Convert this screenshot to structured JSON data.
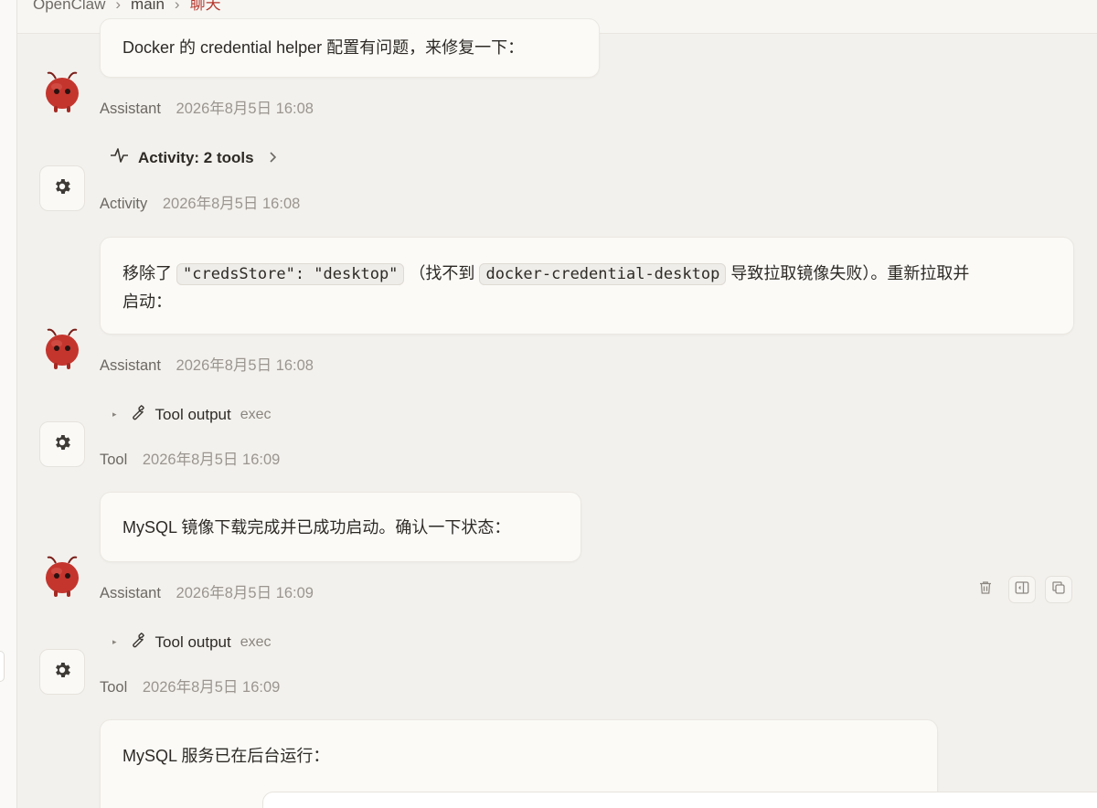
{
  "breadcrumb": {
    "root": "OpenClaw",
    "branch": "main",
    "current": "聊天",
    "separator": "›"
  },
  "messages": [
    {
      "text": "Docker 的 credential helper 配置有问题，来修复一下：",
      "role": "Assistant",
      "time": "2026年8月5日 16:08"
    },
    {
      "activity_label": "Activity: 2 tools",
      "role": "Activity",
      "time": "2026年8月5日 16:08"
    },
    {
      "text_before": "移除了",
      "code1": "\"credsStore\": \"desktop\"",
      "text_mid": "（找不到",
      "code2": "docker-credential-desktop",
      "text_after": "导致拉取镜像失败）。重新拉取并",
      "text_line2": "启动：",
      "role": "Assistant",
      "time": "2026年8月5日 16:08"
    },
    {
      "tool_label": "Tool output",
      "tool_name": "exec",
      "role": "Tool",
      "time": "2026年8月5日 16:09"
    },
    {
      "text": "MySQL 镜像下载完成并已成功启动。确认一下状态：",
      "role": "Assistant",
      "time": "2026年8月5日 16:09"
    },
    {
      "tool_label": "Tool output",
      "tool_name": "exec",
      "role": "Tool",
      "time": "2026年8月5日 16:09"
    },
    {
      "text": "MySQL 服务已在后台运行："
    }
  ],
  "icons": {
    "assistant_avatar": "lobster-avatar-icon",
    "tool_avatar": "gear-icon",
    "activity": "pulse-icon",
    "tool": "wrench-icon",
    "delete": "trash-icon",
    "sidebar": "sidebar-toggle-icon",
    "copy": "copy-icon"
  },
  "colors": {
    "accent": "#b5362c",
    "background": "#f3f1ed",
    "bubble": "#fbfaf7"
  }
}
